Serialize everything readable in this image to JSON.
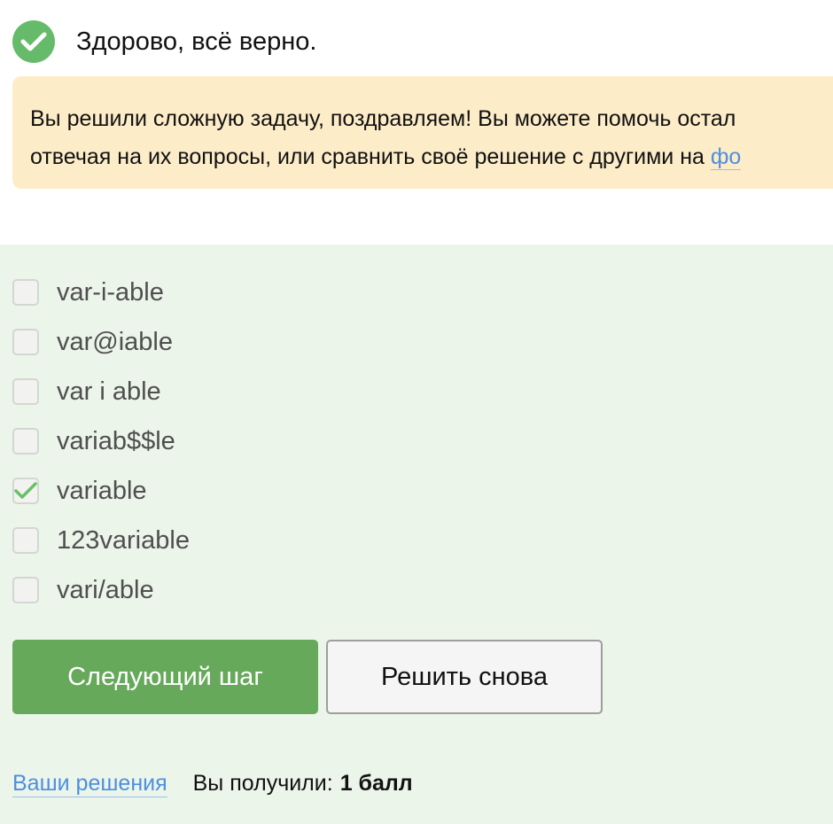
{
  "success": {
    "icon": "check-circle-icon",
    "message": "Здорово, всё верно."
  },
  "hint": {
    "line1": "Вы решили сложную задачу, поздравляем! Вы можете помочь остал",
    "line2": "отвечая на их вопросы, или сравнить своё решение с другими на ",
    "link_text": "фо"
  },
  "quiz": {
    "options": [
      {
        "label": "var-i-able",
        "checked": false
      },
      {
        "label": "var@iable",
        "checked": false
      },
      {
        "label": "var i able",
        "checked": false
      },
      {
        "label": "variab$$le",
        "checked": false
      },
      {
        "label": "variable",
        "checked": true
      },
      {
        "label": "123variable",
        "checked": false
      },
      {
        "label": "vari/able",
        "checked": false
      }
    ]
  },
  "actions": {
    "next_label": "Следующий шаг",
    "retry_label": "Решить снова"
  },
  "footer": {
    "solutions_link": "Ваши решения",
    "score_label": "Вы получили:",
    "score_value": "1 балл"
  },
  "colors": {
    "accent_green": "#66a95a",
    "success_icon": "#66bb6a",
    "hint_background": "#fdecc8",
    "panel_background": "#ecf5ea",
    "link": "#4d8fe0"
  }
}
